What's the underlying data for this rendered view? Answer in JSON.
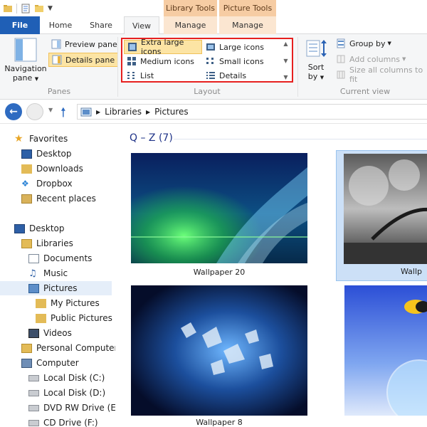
{
  "titlebar": {
    "context_tabs": [
      "Library Tools",
      "Picture Tools"
    ]
  },
  "ribbon_tabs": {
    "file": "File",
    "home": "Home",
    "share": "Share",
    "view": "View",
    "manage1": "Manage",
    "manage2": "Manage"
  },
  "panes": {
    "navigation_pane": "Navigation",
    "navigation_pane_2": "pane",
    "preview_pane": "Preview pane",
    "details_pane": "Details pane",
    "group_label": "Panes"
  },
  "layout": {
    "extra_large_icons": "Extra large icons",
    "large_icons": "Large icons",
    "medium_icons": "Medium icons",
    "small_icons": "Small icons",
    "list": "List",
    "details": "Details",
    "group_label": "Layout"
  },
  "sort": {
    "label": "Sort",
    "label2": "by"
  },
  "current_view": {
    "group_by": "Group by",
    "add_columns": "Add columns",
    "size_all_columns": "Size all columns to fit",
    "group_label": "Current view"
  },
  "address": {
    "crumbs": [
      "Libraries",
      "Pictures"
    ]
  },
  "nav": {
    "favorites": "Favorites",
    "desktop_fav": "Desktop",
    "downloads": "Downloads",
    "dropbox": "Dropbox",
    "recent_places": "Recent places",
    "desktop": "Desktop",
    "libraries": "Libraries",
    "documents": "Documents",
    "music": "Music",
    "pictures": "Pictures",
    "my_pictures": "My Pictures",
    "public_pictures": "Public Pictures",
    "videos": "Videos",
    "personal_computer": "Personal Computer",
    "computer": "Computer",
    "local_c": "Local Disk (C:)",
    "local_d": "Local Disk (D:)",
    "dvd_e": "DVD RW Drive (E:)",
    "cd_f": "CD Drive (F:)"
  },
  "content": {
    "group_header": "Q – Z (7)",
    "tiles": [
      {
        "name": "Wallpaper 20"
      },
      {
        "name": "Wallp"
      },
      {
        "name": "Wallpaper 8"
      },
      {
        "name": ""
      }
    ]
  },
  "colors": {
    "file_tab": "#1f5fb6",
    "context_tab": "#f6cca3",
    "highlight_border": "#e6201f",
    "selected_item": "#fce4a4",
    "link_header": "#1e3287"
  }
}
